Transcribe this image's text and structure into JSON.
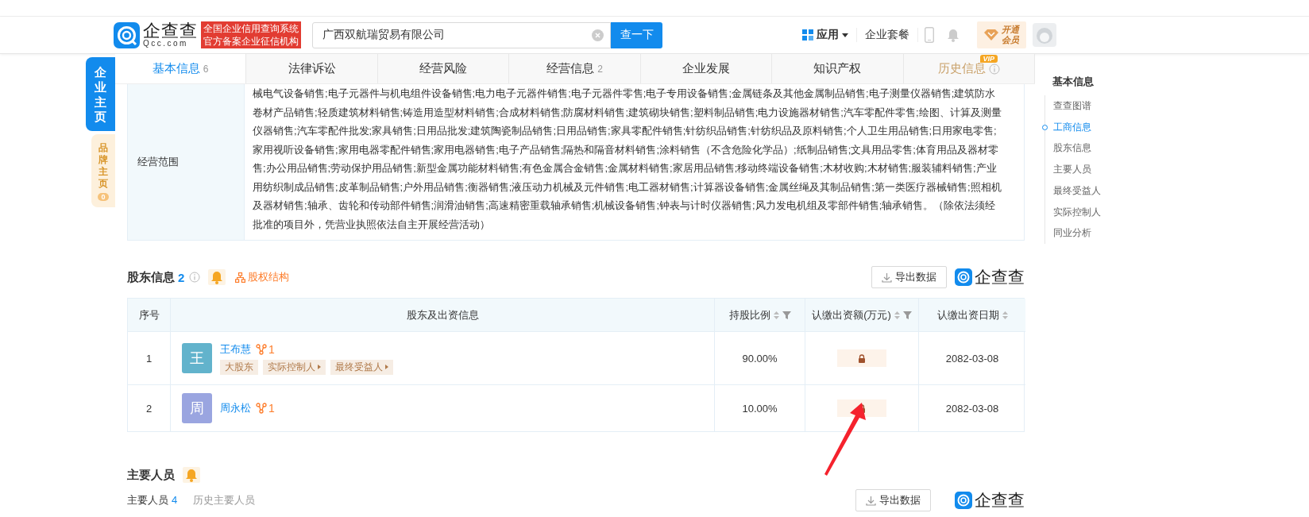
{
  "header": {
    "logo_text": "企查查",
    "logo_domain": "Qcc.com",
    "badge_lines": [
      "全国企业信用查询系统",
      "官方备案企业征信机构"
    ],
    "search": {
      "value": "广西双航瑞贸易有限公司"
    },
    "search_button": "查一下",
    "nav": [
      {
        "kind": "apps",
        "label": "应用"
      },
      {
        "kind": "text",
        "label": "企业套餐"
      },
      {
        "kind": "phone"
      },
      {
        "kind": "bell"
      }
    ],
    "vip_lines": [
      "开通",
      "会员"
    ]
  },
  "side_tabs": [
    {
      "label": "企业主页",
      "selected": true
    },
    {
      "label": "品牌主页",
      "selected": false,
      "count": "0"
    }
  ],
  "tabs": [
    {
      "label": "基本信息",
      "count": "6",
      "selected": true
    },
    {
      "label": "法律诉讼",
      "selected": false
    },
    {
      "label": "经营风险",
      "selected": false
    },
    {
      "label": "经营信息",
      "count": "2",
      "selected": false
    },
    {
      "label": "企业发展",
      "selected": false
    },
    {
      "label": "知识产权",
      "selected": false
    },
    {
      "label": "历史信息",
      "selected": false,
      "vip_badge": "VIP",
      "info": true
    }
  ],
  "scope": {
    "label": "经营范围",
    "lines": [
      "械电气设备销售;电子元器件与机电组件设备销售;电力电子元器件销售;电子元器件零售;电子专用设备销售;金属链条及其他金属制品销售;电子测量仪器销售;建筑防水",
      "卷材产品销售;轻质建筑材料销售;铸造用造型材料销售;合成材料销售;防腐材料销售;建筑砌块销售;塑料制品销售;电力设施器材销售;汽车零配件零售;绘图、计算及测量",
      "仪器销售;汽车零配件批发;家具销售;日用品批发;建筑陶瓷制品销售;日用品销售;家具零配件销售;针纺织品销售;针纺织品及原料销售;个人卫生用品销售;日用家电零售;",
      "家用视听设备销售;家用电器零配件销售;家用电器销售;电子产品销售;隔热和隔音材料销售;涂料销售（不含危险化学品）;纸制品销售;文具用品零售;体育用品及器材零",
      "售;办公用品销售;劳动保护用品销售;新型金属功能材料销售;有色金属合金销售;金属材料销售;家居用品销售;移动终端设备销售;木材收购;木材销售;服装辅料销售;产业",
      "用纺织制成品销售;皮革制品销售;户外用品销售;衡器销售;液压动力机械及元件销售;电工器材销售;计算器设备销售;金属丝绳及其制品销售;第一类医疗器械销售;照相机",
      "及器材销售;轴承、齿轮和传动部件销售;润滑油销售;高速精密重载轴承销售;机械设备销售;钟表与计时仪器销售;风力发电机组及零部件销售;轴承销售。（除依法须经",
      "批准的项目外，凭营业执照依法自主开展经营活动）"
    ]
  },
  "shareholders": {
    "title": "股东信息",
    "count": "2",
    "link": "股权结构",
    "export": "导出数据",
    "brand": "企查查",
    "columns": [
      {
        "label": "序号",
        "sortable": false,
        "filterable": false
      },
      {
        "label": "股东及出资信息",
        "sortable": false,
        "filterable": false
      },
      {
        "label": "持股比例",
        "sortable": true,
        "filterable": true
      },
      {
        "label": "认缴出资额(万元)",
        "sortable": true,
        "filterable": true
      },
      {
        "label": "认缴出资日期",
        "sortable": true,
        "filterable": false
      }
    ],
    "rows": [
      {
        "index": "1",
        "avatar": "王",
        "color": "#62b3cc",
        "name": "王布慧",
        "relations": "1",
        "tags": [
          {
            "label": "大股东",
            "has_arrow": false
          },
          {
            "label": "实际控制人",
            "has_arrow": true
          },
          {
            "label": "最终受益人",
            "has_arrow": true
          }
        ],
        "ratio": "90.00%",
        "locked": true,
        "date": "2082-03-08"
      },
      {
        "index": "2",
        "avatar": "周",
        "color": "#9aa5e0",
        "name": "周永松",
        "relations": "1",
        "tags": [],
        "ratio": "10.00%",
        "locked": true,
        "date": "2082-03-08"
      }
    ]
  },
  "key_people": {
    "title": "主要人员",
    "subtabs": [
      {
        "label": "主要人员",
        "count": "4",
        "selected": true
      },
      {
        "label": "历史主要人员",
        "selected": false
      }
    ],
    "export": "导出数据",
    "brand": "企查查"
  },
  "outline": {
    "heading": "基本信息",
    "items": [
      {
        "label": "查查图谱",
        "selected": false
      },
      {
        "label": "工商信息",
        "selected": true
      },
      {
        "label": "股东信息",
        "selected": false
      },
      {
        "label": "主要人员",
        "selected": false
      },
      {
        "label": "最终受益人",
        "selected": false
      },
      {
        "label": "实际控制人",
        "selected": false
      },
      {
        "label": "同业分析",
        "selected": false
      }
    ]
  }
}
